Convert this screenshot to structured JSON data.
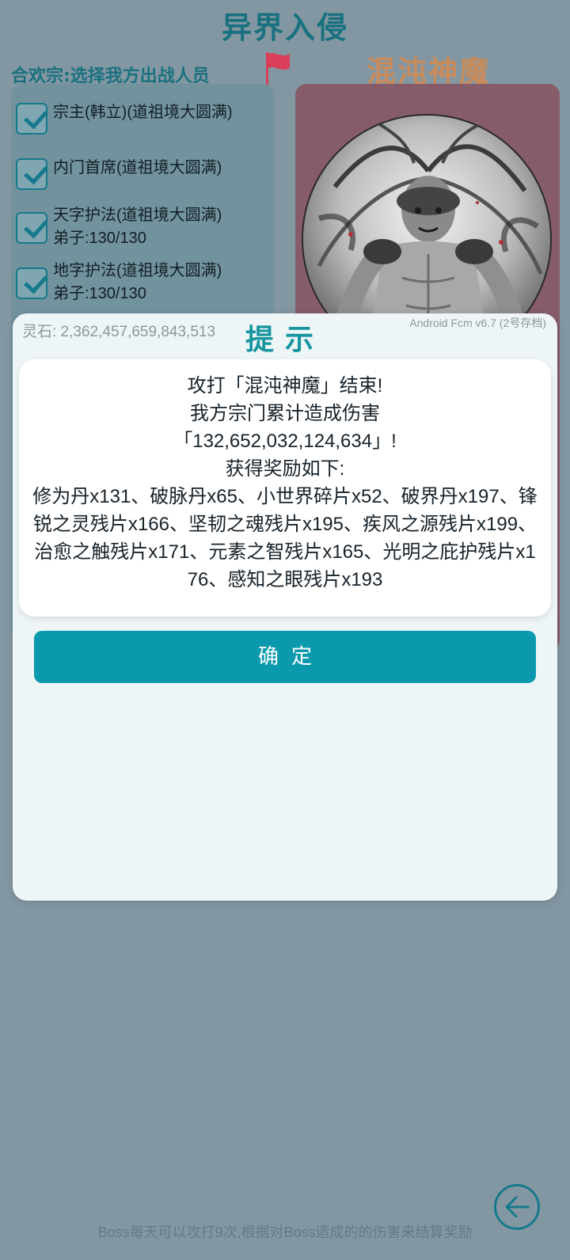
{
  "screen": {
    "title": "异界入侵",
    "section_label": "合欢宗:选择我方出战人员",
    "boss_name": "混沌神魔",
    "members": [
      {
        "line1": "宗主(韩立)(道祖境大圆满)",
        "line2": "",
        "checked": true
      },
      {
        "line1": "内门首席(道祖境大圆满)",
        "line2": "",
        "checked": true
      },
      {
        "line1": "天字护法(道祖境大圆满)",
        "line2": "弟子:130/130",
        "checked": true
      },
      {
        "line1": "地字护法(道祖境大圆满)",
        "line2": "弟子:130/130",
        "checked": true
      }
    ],
    "footer_note": "Boss每天可以攻打9次,根据对Boss造成的的伤害来结算奖励"
  },
  "modal": {
    "currency": "灵石: 2,362,457,659,843,513",
    "version": "Android Fcm v6.7 (2号存档)",
    "title": "提示",
    "message": {
      "line1": "攻打「混沌神魔」结束!",
      "line2": "我方宗门累计造成伤害",
      "line3": "「132,652,032,124,634」!",
      "line4": "获得奖励如下:",
      "rewards": "修为丹x131、破脉丹x65、小世界碎片x52、破界丹x197、锋锐之灵残片x166、坚韧之魂残片x195、疾风之源残片x199、治愈之触残片x171、元素之智残片x165、光明之庇护残片x176、感知之眼残片x193"
    },
    "confirm_label": "确定"
  },
  "icons": {
    "flag": "flag-icon",
    "check": "checkbox-checked-icon",
    "back": "back-arrow-icon"
  },
  "colors": {
    "accent": "#0b9aad",
    "title": "#19717f",
    "boss_name": "#c88b5c",
    "boss_panel": "#875c6a",
    "flag": "#d93e5a"
  }
}
